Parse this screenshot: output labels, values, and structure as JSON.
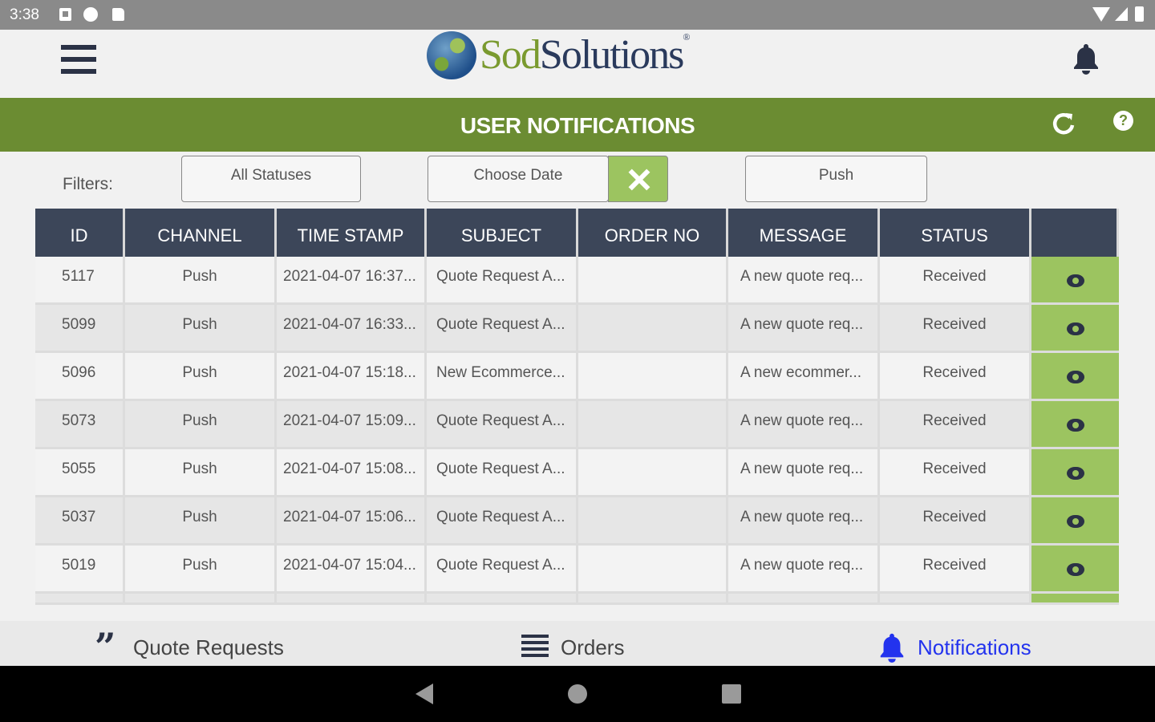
{
  "status_bar": {
    "time": "3:38"
  },
  "header": {
    "logo_sod": "Sod",
    "logo_solutions": "Solutions",
    "logo_mark": "®"
  },
  "title_bar": {
    "title": "USER NOTIFICATIONS"
  },
  "filters": {
    "label": "Filters:",
    "status": "All Statuses",
    "date": "Choose Date",
    "channel": "Push"
  },
  "table": {
    "columns": [
      "ID",
      "CHANNEL",
      "TIME STAMP",
      "SUBJECT",
      "ORDER NO",
      "MESSAGE",
      "STATUS",
      ""
    ],
    "rows": [
      {
        "id": "5117",
        "channel": "Push",
        "timestamp": "2021-04-07 16:37...",
        "subject": "Quote Request A...",
        "order_no": "",
        "message": "A new quote req...",
        "status": "Received"
      },
      {
        "id": "5099",
        "channel": "Push",
        "timestamp": "2021-04-07 16:33...",
        "subject": "Quote Request A...",
        "order_no": "",
        "message": "A new quote req...",
        "status": "Received"
      },
      {
        "id": "5096",
        "channel": "Push",
        "timestamp": "2021-04-07 15:18...",
        "subject": "New Ecommerce...",
        "order_no": "",
        "message": "A new ecommer...",
        "status": "Received"
      },
      {
        "id": "5073",
        "channel": "Push",
        "timestamp": "2021-04-07 15:09...",
        "subject": "Quote Request A...",
        "order_no": "",
        "message": "A new quote req...",
        "status": "Received"
      },
      {
        "id": "5055",
        "channel": "Push",
        "timestamp": "2021-04-07 15:08...",
        "subject": "Quote Request A...",
        "order_no": "",
        "message": "A new quote req...",
        "status": "Received"
      },
      {
        "id": "5037",
        "channel": "Push",
        "timestamp": "2021-04-07 15:06...",
        "subject": "Quote Request A...",
        "order_no": "",
        "message": "A new quote req...",
        "status": "Received"
      },
      {
        "id": "5019",
        "channel": "Push",
        "timestamp": "2021-04-07 15:04...",
        "subject": "Quote Request A...",
        "order_no": "",
        "message": "A new quote req...",
        "status": "Received"
      }
    ]
  },
  "bottom_nav": {
    "items": [
      {
        "label": "Quote Requests",
        "icon": "quote-icon"
      },
      {
        "label": "Orders",
        "icon": "list-icon"
      },
      {
        "label": "Notifications",
        "icon": "bell-icon",
        "active": true
      }
    ]
  },
  "colors": {
    "brand_green": "#6b8c32",
    "action_green": "#9cc460",
    "header_navy": "#3c4659",
    "active_blue": "#2333ee"
  }
}
